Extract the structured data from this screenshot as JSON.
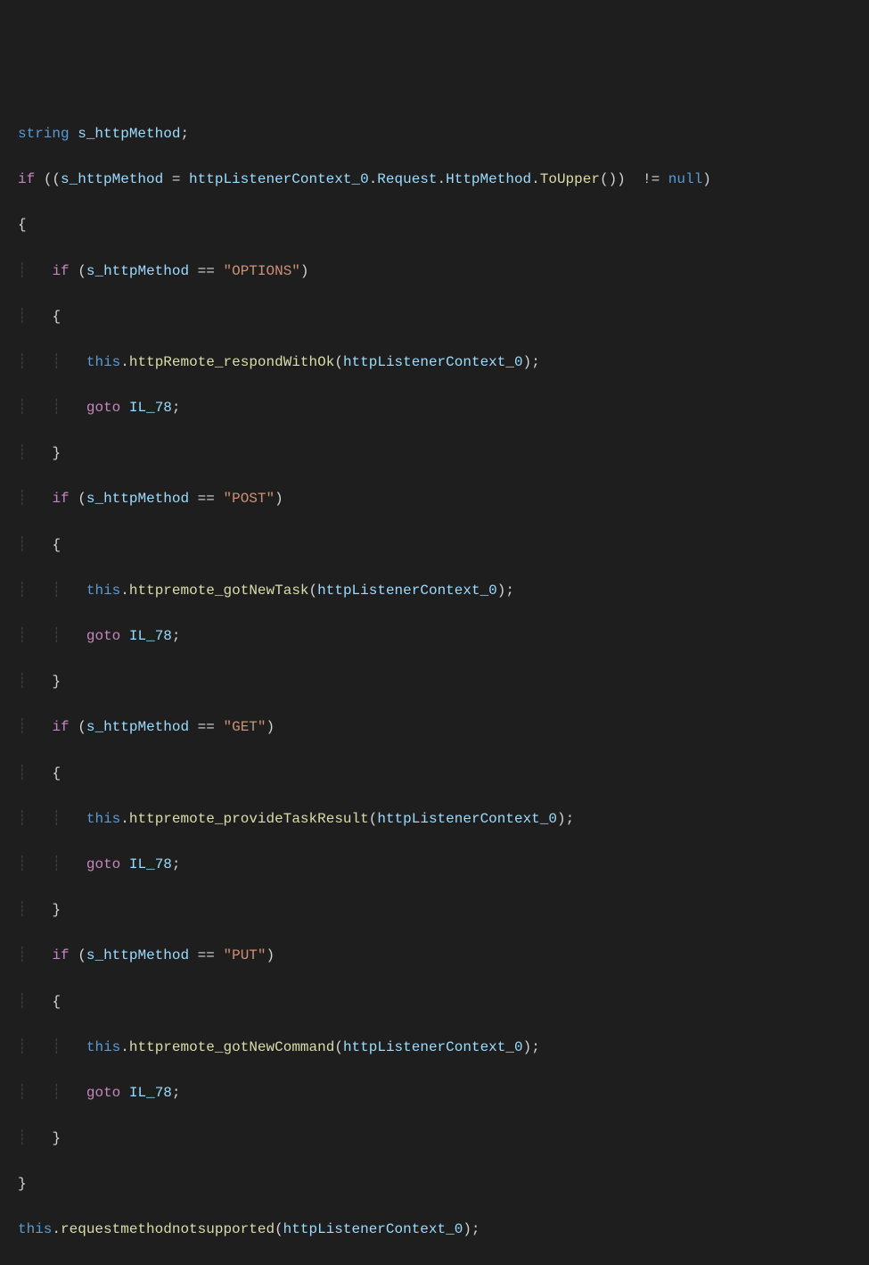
{
  "code": {
    "kw_string": "string",
    "kw_if": "if",
    "kw_this": "this",
    "kw_goto": "goto",
    "kw_null": "null",
    "var_s_httpMethod": "s_httpMethod",
    "var_httpListenerContext_0": "httpListenerContext_0",
    "prop_Request": "Request",
    "prop_HttpMethod": "HttpMethod",
    "method_ToUpper": "ToUpper",
    "method_httpRemote_respondWithOk": "httpRemote_respondWithOk",
    "method_httpremote_gotNewTask": "httpremote_gotNewTask",
    "method_httpremote_provideTaskResult": "httpremote_provideTaskResult",
    "method_httpremote_gotNewCommand": "httpremote_gotNewCommand",
    "method_requestmethodnotsupported": "requestmethodnotsupported",
    "str_OPTIONS": "\"OPTIONS\"",
    "str_POST": "\"POST\"",
    "str_GET": "\"GET\"",
    "str_PUT": "\"PUT\"",
    "label_IL_78": "IL_78",
    "op_assign": " = ",
    "op_eq": " == ",
    "op_neq": " != ",
    "dot": ".",
    "semi": ";",
    "lparen": "(",
    "rparen": ")",
    "lbrace": "{",
    "rbrace": "}",
    "dbl_lparen": "((",
    "dbl_rparen": "()) ",
    "indent1": "    ",
    "indent2": "        ",
    "pipe1": "┊   ",
    "pipe2": "┊   ┊   "
  }
}
